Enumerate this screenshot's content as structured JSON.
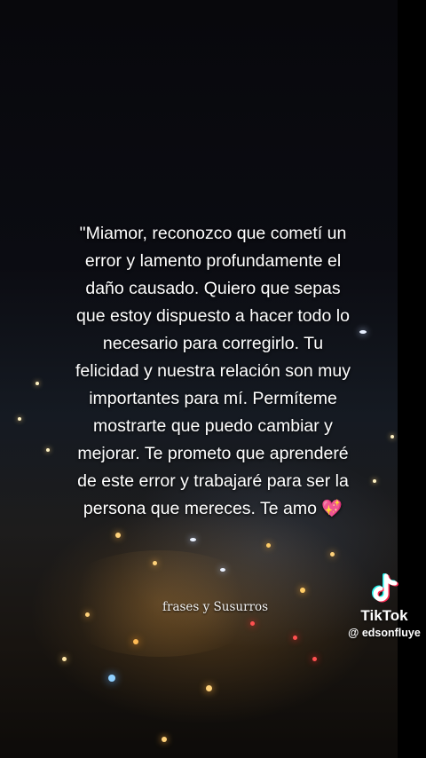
{
  "caption": {
    "lines": [
      "\"Miamor, reconozco que cometí un",
      "error y lamento profundamente el",
      "daño causado. Quiero que sepas",
      "que estoy dispuesto a hacer todo lo",
      "necesario para corregirlo. Tu",
      "felicidad y nuestra relación son muy",
      "importantes para mí. Permíteme",
      "mostrarte que puedo cambiar y",
      "mejorar. Te prometo que aprenderé",
      "de este error y trabajaré para ser la",
      "persona que mereces. Te amo"
    ],
    "emoji": "💖"
  },
  "watermark": "frases y Susurros",
  "tiktok": {
    "brand": "TikTok",
    "handle": "@ edsonfluye",
    "logo_icon": "tiktok-note-icon"
  },
  "colors": {
    "text": "#ffffff",
    "tiktok_cyan": "#25f4ee",
    "tiktok_red": "#fe2c55"
  }
}
